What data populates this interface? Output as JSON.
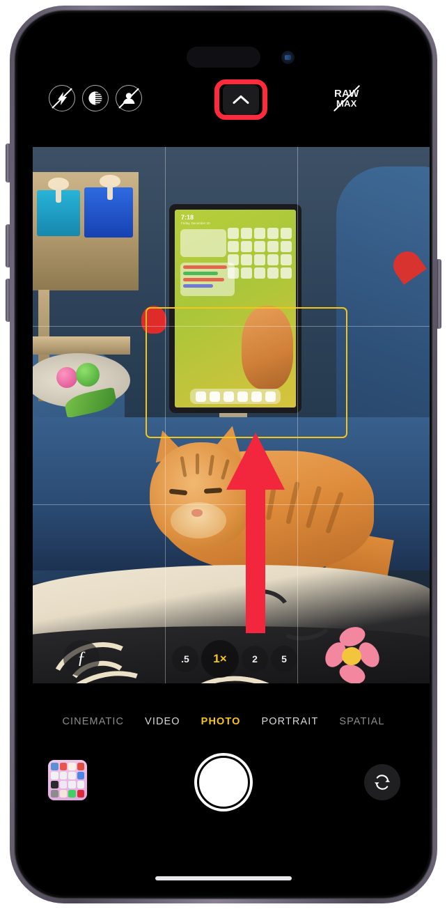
{
  "device": {
    "name": "iPhone",
    "dynamic_island": "dynamic-island",
    "front_camera": "front-camera-lens"
  },
  "top_controls": {
    "flash": {
      "label": "",
      "icon": "flash-off-icon",
      "state": "off"
    },
    "night_mode": {
      "label": "",
      "icon": "night-mode-icon",
      "state": "on"
    },
    "live_photo": {
      "label": "",
      "icon": "live-photo-off-icon",
      "state": "off"
    },
    "more_options": {
      "label": "",
      "icon": "chevron-up-icon",
      "highlighted": true
    },
    "raw_max": {
      "line1": "RAW",
      "line2": "MAX",
      "icon": "raw-max-off-icon",
      "state": "off"
    },
    "photographic_styles": {
      "label": "",
      "icon": "photographic-styles-icon"
    },
    "effects": {
      "label": "",
      "icon": "effects-grid-icon"
    }
  },
  "viewfinder": {
    "grid_enabled": true,
    "face_detect_box": true,
    "scene_description": "Orange tabby cat resting on a blue couch with a patterned blanket in front and an iPad on a stand in the background"
  },
  "annotation": {
    "arrow": {
      "direction": "up",
      "color": "#f2263c",
      "points_to": "more-options-button"
    },
    "highlight_color": "#ff2b3d"
  },
  "zoom_controls": {
    "depth_button_label": "ƒ",
    "levels": [
      {
        "label": ".5",
        "active": false
      },
      {
        "label": "1×",
        "active": true
      },
      {
        "label": "2",
        "active": false
      },
      {
        "label": "5",
        "active": false
      }
    ]
  },
  "mode_selector": {
    "modes": [
      {
        "label": "CINEMATIC",
        "active": false
      },
      {
        "label": "VIDEO",
        "active": false
      },
      {
        "label": "PHOTO",
        "active": true
      },
      {
        "label": "PORTRAIT",
        "active": false
      },
      {
        "label": "SPATIAL",
        "active": false
      }
    ],
    "active_color": "#f5c518"
  },
  "bottom_bar": {
    "gallery_thumbnail": {
      "label": "",
      "icon": "gallery-thumbnail"
    },
    "shutter": {
      "label": "",
      "icon": "shutter-button"
    },
    "flip_camera": {
      "label": "",
      "icon": "flip-camera-icon"
    }
  },
  "home_indicator": {
    "label": ""
  },
  "thumbnail_app_colors": [
    "#5b8fd6",
    "#e8554f",
    "#f5f2e8",
    "#e24b3f",
    "#f2f2f4",
    "#f0f0f3",
    "#f0f0f3",
    "#4a86e8",
    "#2b2b2e",
    "#f0e7f5",
    "#f0f0f3",
    "#f0f0f3",
    "#8c8c90",
    "#f3e6d8",
    "#43d063",
    "#e0283c"
  ]
}
